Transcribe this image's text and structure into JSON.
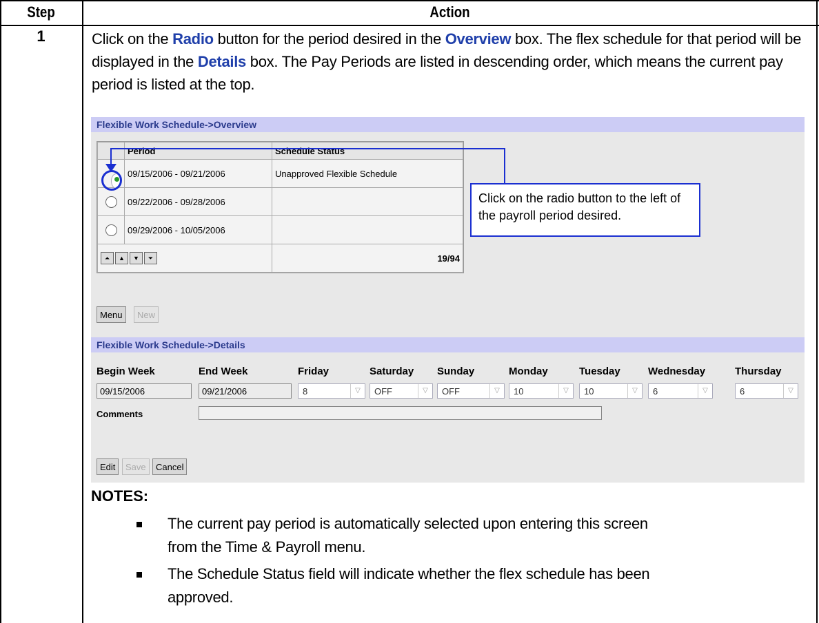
{
  "table": {
    "step_header": "Step",
    "action_header": "Action",
    "step_number": "1"
  },
  "instruction": {
    "p1": "Click on the ",
    "radio": "Radio",
    "p2": " button for the period desired in the ",
    "overview": "Overview",
    "p3": " box.  The flex schedule for that period will be displayed in the ",
    "details": "Details",
    "p4": " box.  The Pay Periods are listed in descending order, which means the current pay period is listed at the top."
  },
  "overview": {
    "title": "Flexible Work Schedule->Overview",
    "col_period": "Period",
    "col_status": "Schedule Status",
    "rows": [
      {
        "period": "09/15/2006 - 09/21/2006",
        "status": "Unapproved Flexible Schedule"
      },
      {
        "period": "09/22/2006 - 09/28/2006",
        "status": ""
      },
      {
        "period": "09/29/2006 - 10/05/2006",
        "status": ""
      }
    ],
    "page_count": "19/94",
    "menu_label": "Menu",
    "new_label": "New"
  },
  "callout": "Click on the radio button to the left of the payroll period desired.",
  "details": {
    "title": "Flexible Work Schedule->Details",
    "labels": [
      "Begin Week",
      "End Week",
      "Friday",
      "Saturday",
      "Sunday",
      "Monday",
      "Tuesday",
      "Wednesday",
      "Thursday"
    ],
    "begin_week": "09/15/2006",
    "end_week": "09/21/2006",
    "days": [
      "8",
      "OFF",
      "OFF",
      "10",
      "10",
      "6",
      "6"
    ],
    "comments_label": "Comments",
    "edit_label": "Edit",
    "save_label": "Save",
    "cancel_label": "Cancel"
  },
  "notes": {
    "title": "NOTES:",
    "n1a": "The current pay period is automatically selected upon entering this screen",
    "n1b": "from the Time & Payroll menu.",
    "n2a": "The Schedule Status field will indicate whether the flex schedule has been",
    "n2b": "approved."
  }
}
